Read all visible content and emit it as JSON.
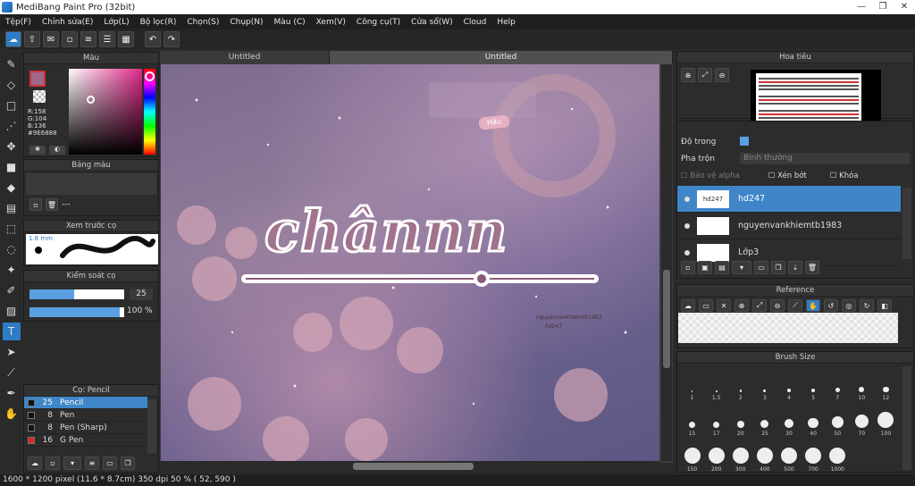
{
  "title": "MediBang Paint Pro (32bit)",
  "menu": [
    "Tệp(F)",
    "Chỉnh sửa(E)",
    "Lớp(L)",
    "Bộ lọc(R)",
    "Chọn(S)",
    "Chụp(N)",
    "Màu (C)",
    "Xem(V)",
    "Công cụ(T)",
    "Cửa sổ(W)",
    "Cloud",
    "Help"
  ],
  "tabs": [
    "Untitled",
    "Untitled"
  ],
  "color_panel": {
    "title": "Màu",
    "r": "R:158",
    "g": "G:104",
    "b": "B:136",
    "hex": "#9E6888",
    "fg": "#9e6888"
  },
  "palette": {
    "title": "Bảng màu",
    "empty": "---"
  },
  "brush_preview": {
    "title": "Xem trước cọ",
    "size": "1.8 mm"
  },
  "brush_control": {
    "title": "Kiểm soát cọ",
    "size": "25",
    "opacity": "100 %",
    "size_fill": 0.47,
    "opacity_fill": 0.95
  },
  "brushes": {
    "title": "Cọ: Pencil",
    "items": [
      {
        "n": "25",
        "name": "Pencil",
        "color": "#111111",
        "sel": true
      },
      {
        "n": "8",
        "name": "Pen",
        "color": "#111111",
        "sel": false
      },
      {
        "n": "8",
        "name": "Pen (Sharp)",
        "color": "#111111",
        "sel": false
      },
      {
        "n": "16",
        "name": "G Pen",
        "color": "#e02424",
        "sel": false
      }
    ]
  },
  "artwork": {
    "text": "chânnn",
    "sticker": "Hâu",
    "credit": "nguyenvankhiemtb1983",
    "credit2": "hd247"
  },
  "navigator": {
    "title": "Hoa tiêu"
  },
  "layer_props": {
    "opacity_label": "Độ trong",
    "blend_label": "Pha trộn",
    "blend_value": "Bình thường",
    "protect_alpha": "Bảo vệ alpha",
    "clipping": "Xén bớt",
    "lock": "Khóa"
  },
  "layers": [
    {
      "name": "hd247",
      "thumb": "hd247",
      "sel": true
    },
    {
      "name": "nguyenvankhiemtb1983",
      "thumb": "",
      "sel": false
    },
    {
      "name": "Lớp3",
      "thumb": "",
      "sel": false
    }
  ],
  "reference": {
    "title": "Reference"
  },
  "brush_size": {
    "title": "Brush Size",
    "sizes": [
      "1",
      "1.5",
      "2",
      "3",
      "4",
      "5",
      "7",
      "10",
      "12",
      "15",
      "17",
      "20",
      "25",
      "30",
      "40",
      "50",
      "70",
      "100",
      "150",
      "200",
      "300",
      "400",
      "500",
      "700",
      "1000"
    ]
  },
  "status": "1600 * 1200 pixel   (11.6 * 8.7cm)   350 dpi   50 %   ( 52, 590 )"
}
